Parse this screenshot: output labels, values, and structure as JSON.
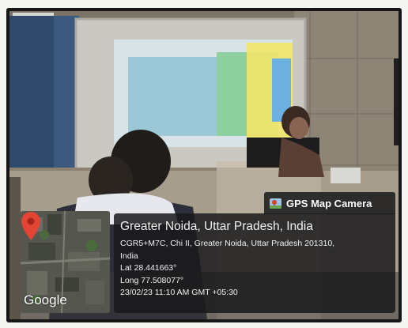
{
  "overlay": {
    "app_badge": "GPS Map Camera",
    "title": "Greater Noida, Uttar Pradesh, India",
    "address_line1": "CGR5+M7C, Chi II, Greater Noida, Uttar Pradesh 201310,",
    "address_line2": "India",
    "latitude": "Lat 28.441663°",
    "longitude": "Long 77.508077°",
    "timestamp": "23/02/23 11:10 AM GMT +05:30"
  },
  "map": {
    "attribution": "Google",
    "icon": "map-pin-icon"
  }
}
